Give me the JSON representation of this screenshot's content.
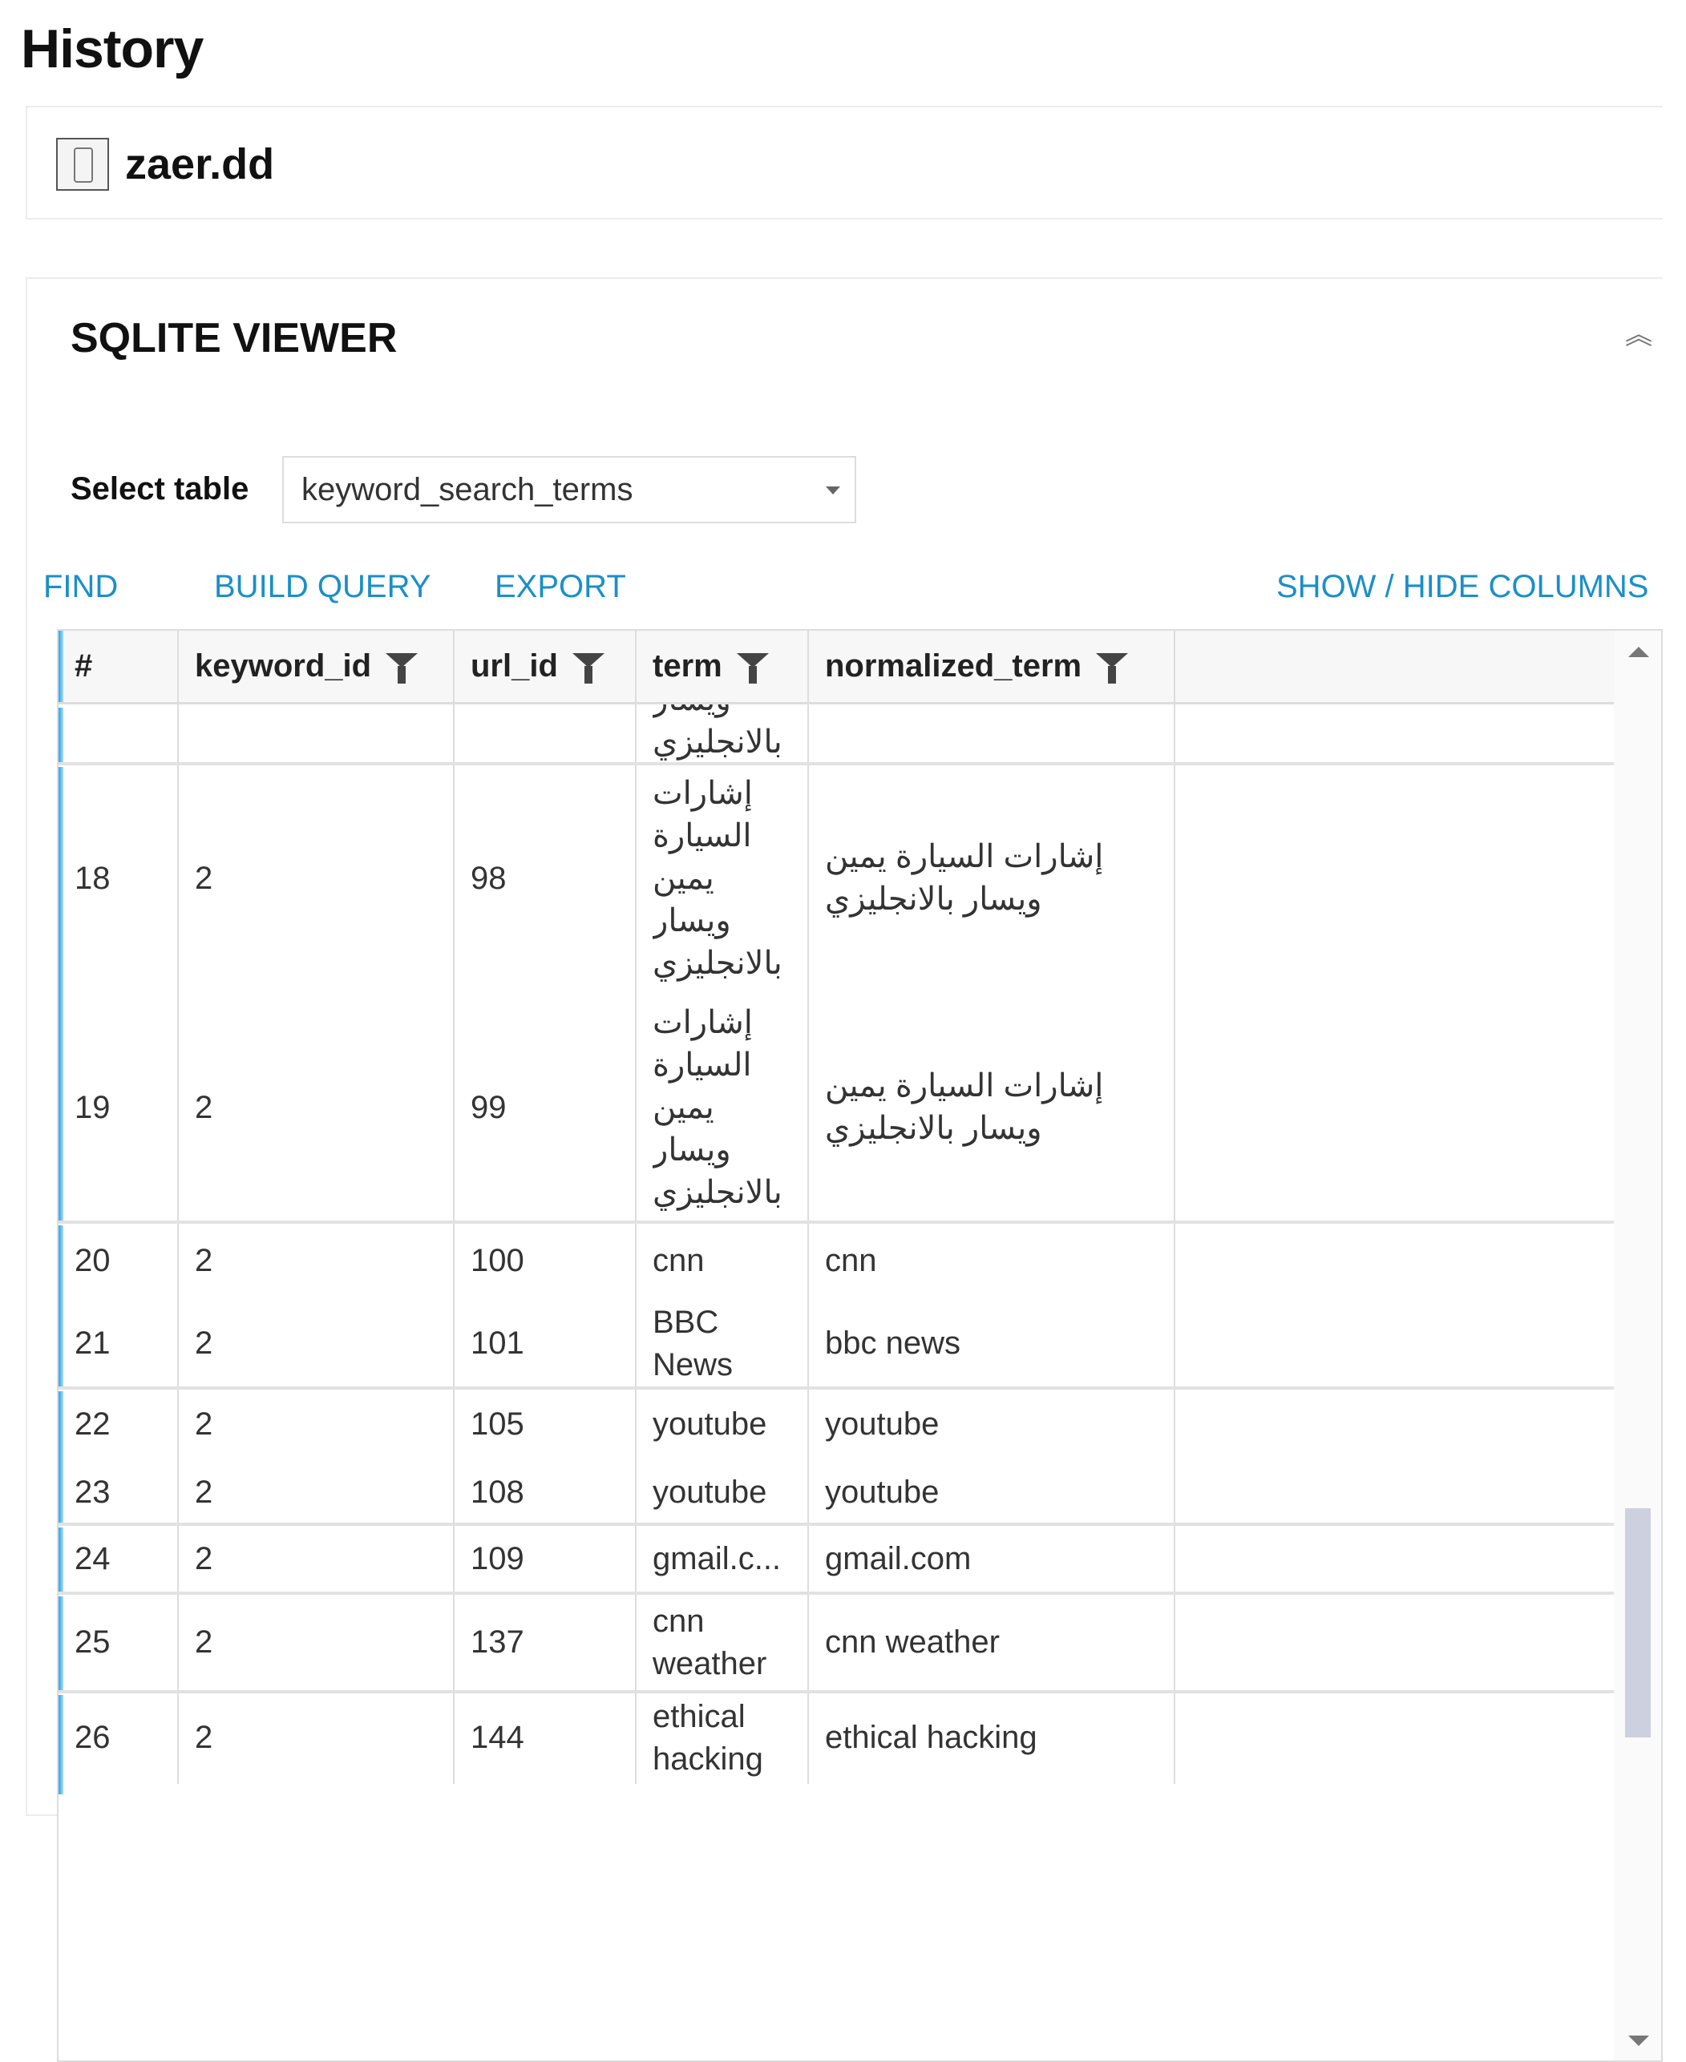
{
  "page": {
    "title": "History"
  },
  "device": {
    "name": "zaer.dd",
    "icon": "phone-icon"
  },
  "viewer": {
    "title": "SQLITE VIEWER",
    "collapse_icon": "double-chevron-up-icon",
    "select_label": "Select table",
    "selected_table": "keyword_search_terms",
    "actions": {
      "find": "FIND",
      "build_query": "BUILD QUERY",
      "export": "EXPORT",
      "show_hide_columns": "SHOW / HIDE COLUMNS"
    },
    "scroll_position": 0.75
  },
  "table": {
    "columns": [
      "#",
      "keyword_id",
      "url_id",
      "term",
      "normalized_term"
    ],
    "rows": [
      {
        "id": "",
        "keyword_id": "",
        "url_id": "",
        "term": "ويسار بالانجليزي",
        "normalized_term": ""
      },
      {
        "id": "18",
        "keyword_id": "2",
        "url_id": "98",
        "term": "إشارات السيارة يمين ويسار بالانجليزي",
        "normalized_term": "إشارات السيارة يمين ويسار بالانجليزي"
      },
      {
        "id": "19",
        "keyword_id": "2",
        "url_id": "99",
        "term": "إشارات السيارة يمين ويسار بالانجليزي",
        "normalized_term": "إشارات السيارة يمين ويسار بالانجليزي"
      },
      {
        "id": "20",
        "keyword_id": "2",
        "url_id": "100",
        "term": "cnn",
        "normalized_term": "cnn"
      },
      {
        "id": "21",
        "keyword_id": "2",
        "url_id": "101",
        "term": "BBC News",
        "normalized_term": "bbc news"
      },
      {
        "id": "22",
        "keyword_id": "2",
        "url_id": "105",
        "term": "youtube",
        "normalized_term": "youtube"
      },
      {
        "id": "23",
        "keyword_id": "2",
        "url_id": "108",
        "term": "youtube",
        "normalized_term": "youtube"
      },
      {
        "id": "24",
        "keyword_id": "2",
        "url_id": "109",
        "term": "gmail.c...",
        "normalized_term": "gmail.com"
      },
      {
        "id": "25",
        "keyword_id": "2",
        "url_id": "137",
        "term": "cnn weather",
        "normalized_term": "cnn weather"
      },
      {
        "id": "26",
        "keyword_id": "2",
        "url_id": "144",
        "term": "ethical hacking",
        "normalized_term": "ethical hacking"
      }
    ]
  }
}
